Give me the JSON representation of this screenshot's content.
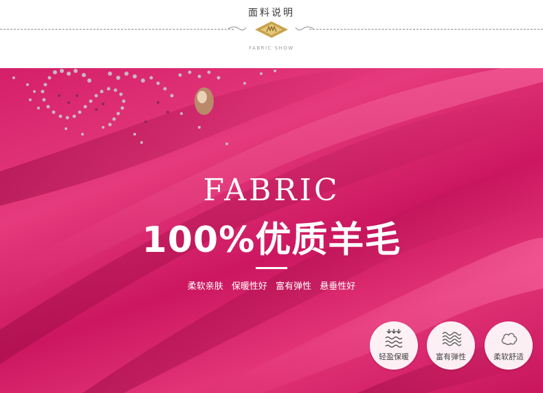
{
  "header": {
    "title": "面料说明",
    "subtitle": "FABRIC SHOW"
  },
  "hero": {
    "fabric_word": "FABRIC",
    "headline": "100%优质羊毛",
    "tagline": "柔软亲肤 保暖性好 富有弹性 悬垂性好"
  },
  "features": [
    {
      "label": "轻盈保暖",
      "icon": "warmth-waves-icon"
    },
    {
      "label": "富有弹性",
      "icon": "elastic-waves-icon"
    },
    {
      "label": "柔软舒适",
      "icon": "cotton-cloud-icon"
    }
  ],
  "colors": {
    "fabric": "#d41f69",
    "emblem_gold": "#c9a24b",
    "text_light": "#ffffff"
  }
}
